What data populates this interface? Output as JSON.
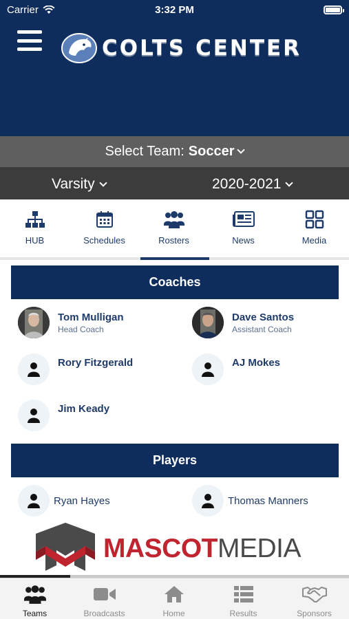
{
  "status": {
    "carrier": "Carrier",
    "time": "3:32 PM"
  },
  "header": {
    "title": "COLTS CENTER"
  },
  "team_selector": {
    "label": "Select Team:",
    "value": "Soccer"
  },
  "level": "Varsity",
  "season": "2020-2021",
  "tabs": [
    {
      "label": "HUB",
      "icon": "hierarchy-icon"
    },
    {
      "label": "Schedules",
      "icon": "calendar-icon"
    },
    {
      "label": "Rosters",
      "icon": "people-icon",
      "active": true
    },
    {
      "label": "News",
      "icon": "newspaper-icon"
    },
    {
      "label": "Media",
      "icon": "grid-icon"
    }
  ],
  "coaches": {
    "title": "Coaches",
    "items": [
      {
        "name": "Tom Mulligan",
        "role": "Head Coach"
      },
      {
        "name": "Dave Santos",
        "role": "Assistant Coach"
      },
      {
        "name": "Rory Fitzgerald"
      },
      {
        "name": "AJ Mokes"
      },
      {
        "name": "Jim Keady"
      }
    ]
  },
  "players": {
    "title": "Players",
    "items": [
      {
        "name": "Ryan Hayes"
      },
      {
        "name": "Thomas Manners"
      }
    ]
  },
  "sponsor": {
    "part1": "MASCOT",
    "part2": "MEDIA"
  },
  "bottom_nav": [
    {
      "label": "Teams",
      "icon": "people-icon",
      "active": true
    },
    {
      "label": "Broadcasts",
      "icon": "video-camera-icon"
    },
    {
      "label": "Home",
      "icon": "home-icon"
    },
    {
      "label": "Results",
      "icon": "list-icon"
    },
    {
      "label": "Sponsors",
      "icon": "handshake-icon"
    }
  ],
  "colors": {
    "navy": "#0f2d5c",
    "link": "#1e3a6b",
    "brand_red": "#c0242f"
  }
}
